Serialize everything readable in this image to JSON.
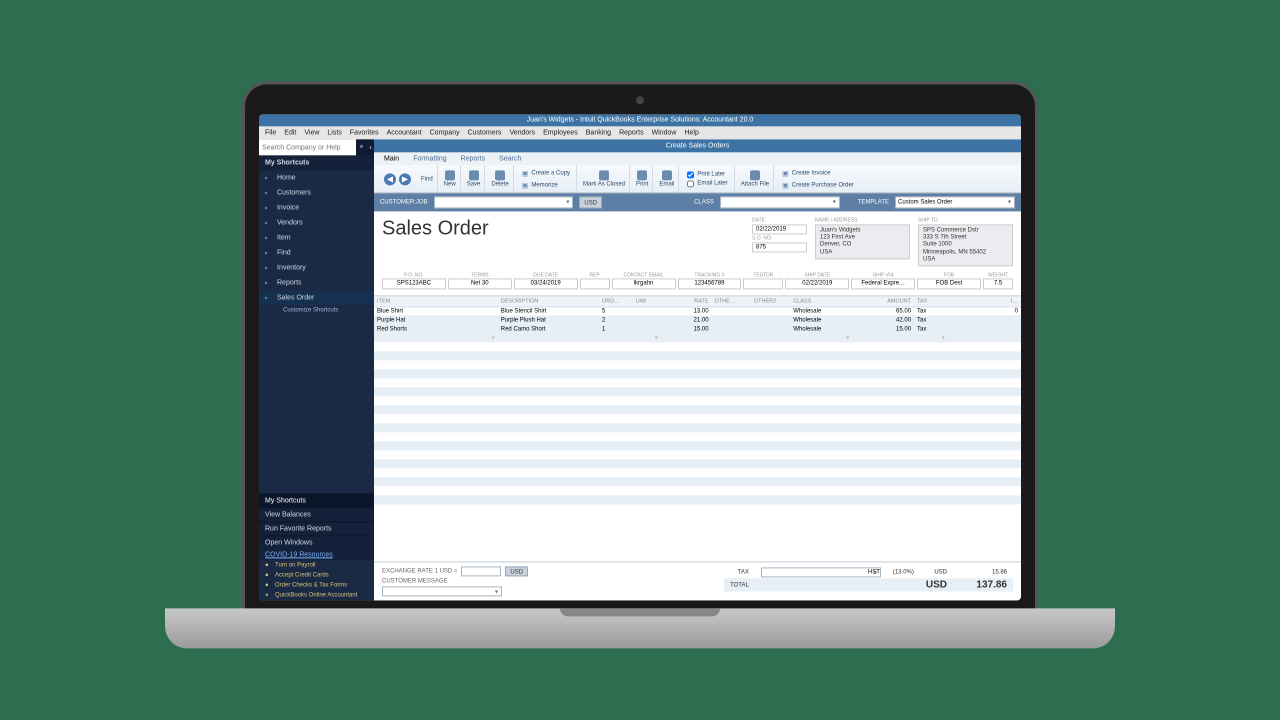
{
  "window": {
    "title": "Juan's Widgets  - Intuit QuickBooks Enterprise Solutions: Accountant 20.0"
  },
  "menubar": [
    "File",
    "Edit",
    "View",
    "Lists",
    "Favorites",
    "Accountant",
    "Company",
    "Customers",
    "Vendors",
    "Employees",
    "Banking",
    "Reports",
    "Window",
    "Help"
  ],
  "sidebar": {
    "search_placeholder": "Search Company or Help",
    "header": "My Shortcuts",
    "items": [
      {
        "label": "Home"
      },
      {
        "label": "Customers"
      },
      {
        "label": "Invoice"
      },
      {
        "label": "Vendors"
      },
      {
        "label": "Item"
      },
      {
        "label": "Find"
      },
      {
        "label": "Inventory"
      },
      {
        "label": "Reports"
      },
      {
        "label": "Sales Order",
        "sel": true
      }
    ],
    "customize": "Customize Shortcuts",
    "sections": [
      {
        "label": "My Shortcuts",
        "sel": true
      },
      {
        "label": "View Balances"
      },
      {
        "label": "Run Favorite Reports"
      },
      {
        "label": "Open Windows"
      }
    ],
    "covid": "COVID-19 Resources",
    "resources": [
      {
        "label": "Turn on Payroll"
      },
      {
        "label": "Accept Credit Cards"
      },
      {
        "label": "Order Checks & Tax Forms"
      },
      {
        "label": "QuickBooks Online Accountant",
        "g": true
      }
    ]
  },
  "tabTitle": "Create Sales Orders",
  "subtabs": [
    "Main",
    "Formatting",
    "Reports",
    "Search"
  ],
  "ribbon": {
    "find": "Find",
    "new": "New",
    "save": "Save",
    "delete": "Delete",
    "create_copy": "Create a Copy",
    "memorize": "Memorize",
    "mark_closed": "Mark As Closed",
    "print": "Print",
    "email": "Email",
    "print_later": "Print Later",
    "email_later": "Email Later",
    "attach": "Attach File",
    "create_invoice": "Create Invoice",
    "create_po": "Create Purchase Order"
  },
  "custrow": {
    "cust_lbl": "CUSTOMER:JOB",
    "cur": "USD",
    "class_lbl": "CLASS",
    "tmpl_lbl": "TEMPLATE",
    "tmpl": "Custom Sales Order"
  },
  "header": {
    "title": "Sales Order",
    "date_lbl": "DATE",
    "date": "02/22/2019",
    "sono_lbl": "S.O. NO.",
    "sono": "875",
    "name_lbl": "NAME / ADDRESS",
    "name_addr": "Juan's Widgets\n123 First Ave\nDenver, CO\nUSA",
    "ship_lbl": "SHIP TO",
    "ship_addr": "SPS Commerce Dstr\n333 S 7th Street\nSuite 1000\nMinneapolis, MN 55402\nUSA"
  },
  "fields": {
    "cols": [
      "P.O. NO.",
      "TERMS",
      "DUE DATE",
      "REP",
      "CONTACT EMAIL",
      "TRACKING #",
      "TESTDR",
      "SHIP DATE",
      "SHIP VIA",
      "FOB",
      "WEIGHT"
    ],
    "vals": [
      "SPS123ABC",
      "Net 30",
      "03/24/2019",
      "",
      "lkrgahn",
      "123456789",
      "",
      "02/22/2019",
      "Federal Expre…",
      "FOB Dest",
      "7.5"
    ]
  },
  "table": {
    "headers": [
      "ITEM",
      "DESCRIPTION",
      "ORD…",
      "U/M",
      "RATE",
      "OTHE…",
      "OTHER2",
      "CLASS",
      "AMOUNT",
      "TAX",
      "",
      "I…"
    ],
    "rows": [
      {
        "item": "Blue Shirt",
        "desc": "Blue Stencil Shirt",
        "ord": "5",
        "rate": "13.00",
        "cls": "Wholesale",
        "amt": "65.00",
        "tax": "Tax",
        "i": "0"
      },
      {
        "item": "Purple Hat",
        "desc": "Purple Plush Hat",
        "ord": "2",
        "rate": "21.00",
        "cls": "Wholesale",
        "amt": "42.00",
        "tax": "Tax"
      },
      {
        "item": "Red Shorts",
        "desc": "Red Camo Short",
        "ord": "1",
        "rate": "15.00",
        "cls": "Wholesale",
        "amt": "15.00",
        "tax": "Tax"
      }
    ]
  },
  "footer": {
    "exch_lbl": "EXCHANGE RATE 1 USD =",
    "exch_cur": "USD",
    "msg_lbl": "CUSTOMER MESSAGE",
    "tax_lbl": "TAX",
    "tax_name": "HST",
    "tax_rate": "(13.0%)",
    "tax_cur": "USD",
    "tax_amt": "15.86",
    "tot_lbl": "TOTAL",
    "tot_cur": "USD",
    "tot_amt": "137.86"
  }
}
